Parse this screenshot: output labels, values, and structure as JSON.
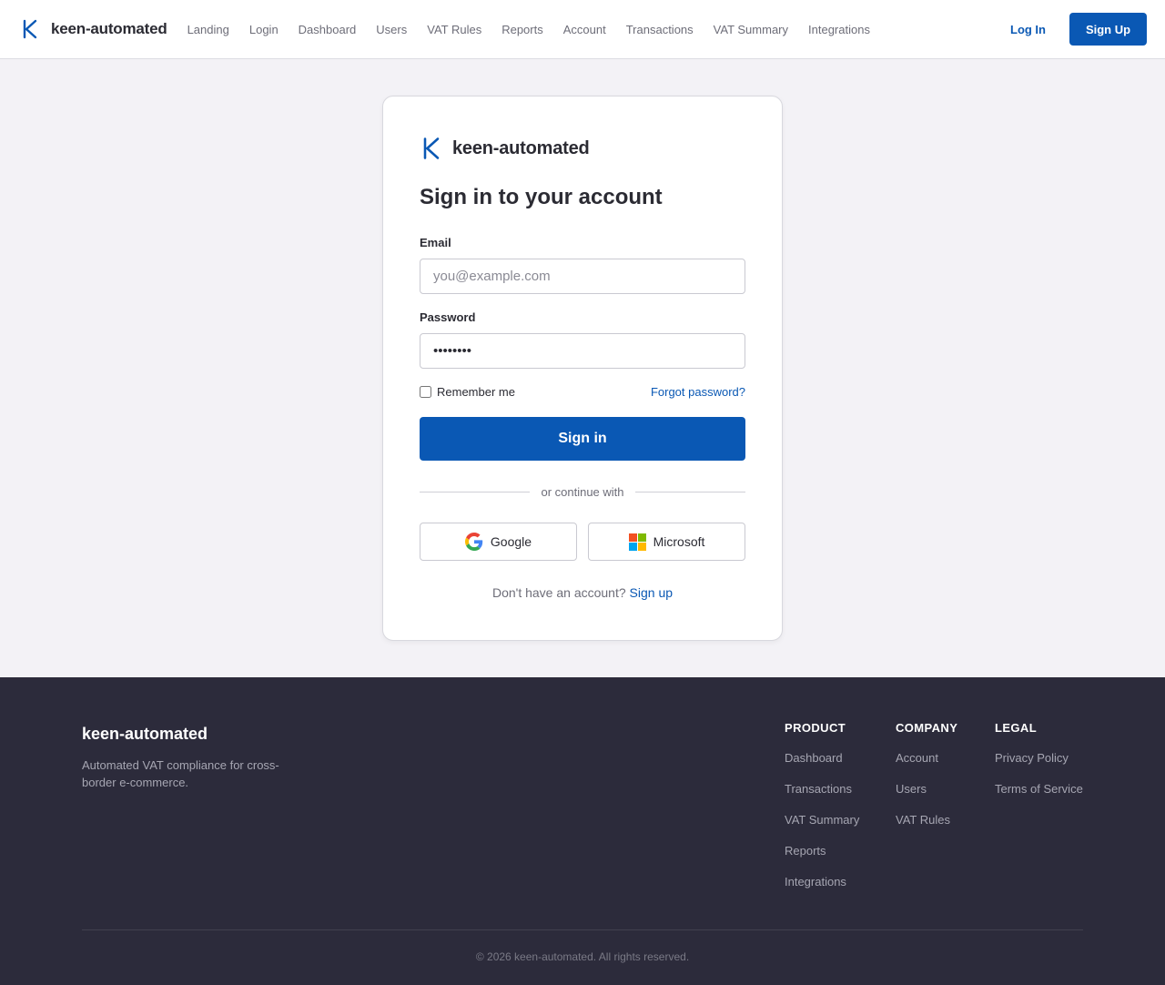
{
  "header": {
    "brand_name": "keen-automated",
    "nav": [
      "Landing",
      "Login",
      "Dashboard",
      "Users",
      "VAT Rules",
      "Reports",
      "Account",
      "Transactions",
      "VAT Summary",
      "Integrations"
    ],
    "login_label": "Log In",
    "signup_label": "Sign Up"
  },
  "card": {
    "brand_name": "keen-automated",
    "title": "Sign in to your account",
    "email_label": "Email",
    "email_placeholder": "you@example.com",
    "password_label": "Password",
    "password_value": "••••••••",
    "remember_label": "Remember me",
    "forgot_label": "Forgot password?",
    "signin_label": "Sign in",
    "divider_text": "or continue with",
    "google_label": "Google",
    "microsoft_label": "Microsoft",
    "no_account_text": "Don't have an account?",
    "signup_link": "Sign up"
  },
  "footer": {
    "brand_name": "keen-automated",
    "description": "Automated VAT compliance for cross-border e-commerce.",
    "columns": [
      {
        "title": "PRODUCT",
        "links": [
          "Dashboard",
          "Transactions",
          "VAT Summary",
          "Reports",
          "Integrations"
        ]
      },
      {
        "title": "COMPANY",
        "links": [
          "Account",
          "Users",
          "VAT Rules"
        ]
      },
      {
        "title": "LEGAL",
        "links": [
          "Privacy Policy",
          "Terms of Service"
        ]
      }
    ],
    "copyright": "© 2026 keen-automated. All rights reserved."
  },
  "colors": {
    "accent": "#0a58b4",
    "footer_bg": "#2c2b3b",
    "page_bg": "#f3f2f6"
  },
  "icons": {
    "brand": "k-logo-icon",
    "google": "google-icon",
    "microsoft": "microsoft-icon"
  }
}
